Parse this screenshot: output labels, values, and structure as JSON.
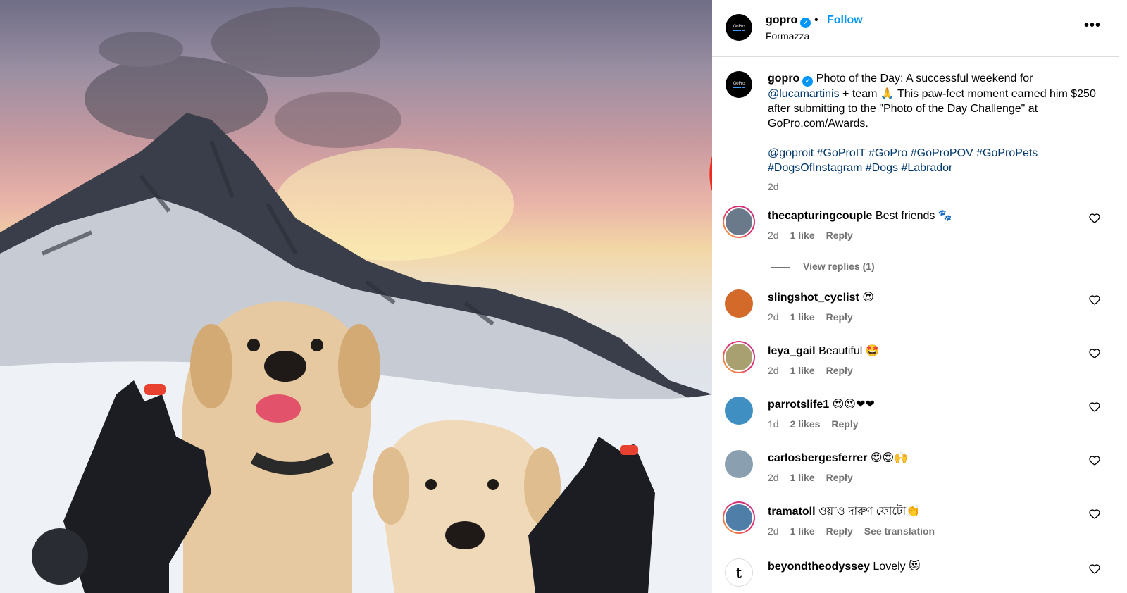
{
  "photo": {
    "alt_subject": "",
    "accent": "#e8412f"
  },
  "header": {
    "username": "gopro",
    "verified": true,
    "separator": "•",
    "follow_label": "Follow",
    "location": "Formazza",
    "more_icon": "more-horizontal-icon",
    "more_glyph": "•••"
  },
  "caption": {
    "username": "gopro",
    "text_1": "Photo of the Day: A successful weekend for",
    "mention": "@lucamartinis",
    "text_2": " + team  🙏  This paw-fect moment earned him $250 after submitting to the \"Photo of the Day Challenge\" at GoPro.com/Awards.",
    "mention_2": "@goproit",
    "hashtags": [
      "#GoProIT",
      "#GoPro",
      "#GoProPOV",
      "#GoProPets",
      "#DogsOfInstagram",
      "#Dogs",
      "#Labrador"
    ],
    "time": "2d"
  },
  "comments": [
    {
      "user": "thecapturingcouple",
      "text": "Best friends 🐾",
      "time": "2d",
      "likes": "1 like",
      "reply": "Reply",
      "extra": "",
      "avatar_color": "#6b7a8a",
      "ring": true
    },
    {
      "user": "slingshot_cyclist",
      "text": "😍",
      "time": "2d",
      "likes": "1 like",
      "reply": "Reply",
      "extra": "",
      "avatar_color": "#d46a2a",
      "ring": false
    },
    {
      "user": "leya_gail",
      "text": "Beautiful 🤩",
      "time": "2d",
      "likes": "1 like",
      "reply": "Reply",
      "extra": "",
      "avatar_color": "#a8a070",
      "ring": true
    },
    {
      "user": "parrotslife1",
      "text": "😍😍❤❤",
      "time": "1d",
      "likes": "2 likes",
      "reply": "Reply",
      "extra": "",
      "avatar_color": "#3f8fc2",
      "ring": false
    },
    {
      "user": "carlosbergesferrer",
      "text": "😍😍🙌",
      "time": "2d",
      "likes": "1 like",
      "reply": "Reply",
      "extra": "",
      "avatar_color": "#8aa0b0",
      "ring": false
    },
    {
      "user": "tramatoll",
      "text": "ওয়াও দারুণ ফোটো👏",
      "time": "2d",
      "likes": "1 like",
      "reply": "Reply",
      "extra": "See translation",
      "avatar_color": "#4f7fa8",
      "ring": true
    },
    {
      "user": "beyondtheodyssey",
      "text": "Lovely 😻",
      "time": "",
      "likes": "",
      "reply": "",
      "extra": "",
      "avatar_color": "#ffffff",
      "ring": false
    }
  ],
  "view_replies": "View replies (1)",
  "heart_icon": "heart-outline-icon"
}
